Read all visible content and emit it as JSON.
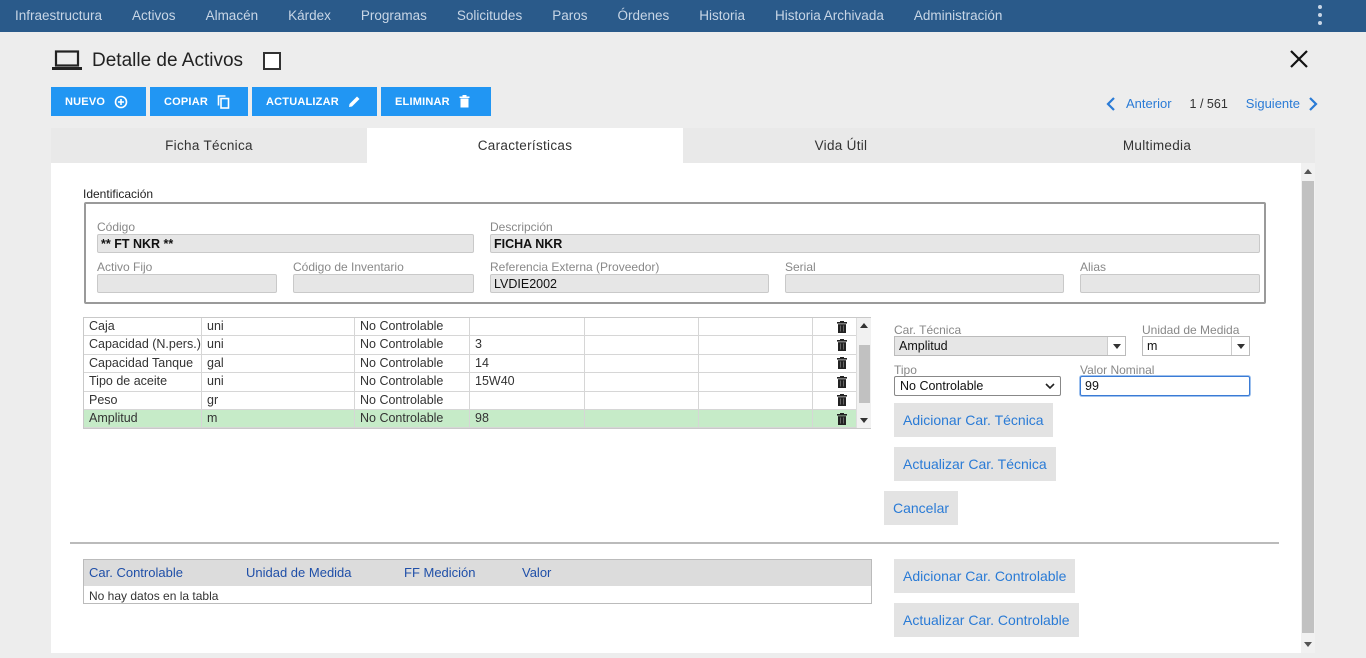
{
  "nav": [
    "Infraestructura",
    "Activos",
    "Almacén",
    "Kárdex",
    "Programas",
    "Solicitudes",
    "Paros",
    "Órdenes",
    "Historia",
    "Historia Archivada",
    "Administración"
  ],
  "page": {
    "title": "Detalle de Activos"
  },
  "toolbar": {
    "nuevo": "NUEVO",
    "copiar": "COPIAR",
    "actualizar": "ACTUALIZAR",
    "eliminar": "ELIMINAR"
  },
  "pager": {
    "prev": "Anterior",
    "count": "1 / 561",
    "next": "Siguiente"
  },
  "tabs": [
    {
      "label": "Ficha Técnica",
      "active": false
    },
    {
      "label": "Características",
      "active": true
    },
    {
      "label": "Vida Útil",
      "active": false
    },
    {
      "label": "Multimedia",
      "active": false
    }
  ],
  "identificacion": {
    "section_label": "Identificación",
    "codigo": {
      "label": "Código",
      "value": "** FT NKR **"
    },
    "descripcion": {
      "label": "Descripción",
      "value": "FICHA NKR"
    },
    "activo_fijo": {
      "label": "Activo Fijo",
      "value": ""
    },
    "codigo_inventario": {
      "label": "Código de Inventario",
      "value": ""
    },
    "referencia_externa": {
      "label": "Referencia Externa (Proveedor)",
      "value": "LVDIE2002"
    },
    "serial": {
      "label": "Serial",
      "value": ""
    },
    "alias": {
      "label": "Alias",
      "value": ""
    }
  },
  "caracteristicas": {
    "rows": [
      {
        "nombre": "Caja",
        "unidad": "uni",
        "tipo": "No Controlable",
        "valor": "",
        "selected": false
      },
      {
        "nombre": "Capacidad (N.pers.)",
        "unidad": "uni",
        "tipo": "No Controlable",
        "valor": "3",
        "selected": false
      },
      {
        "nombre": "Capacidad Tanque",
        "unidad": "gal",
        "tipo": "No Controlable",
        "valor": "14",
        "selected": false
      },
      {
        "nombre": "Tipo de aceite",
        "unidad": "uni",
        "tipo": "No Controlable",
        "valor": "15W40",
        "selected": false
      },
      {
        "nombre": "Peso",
        "unidad": "gr",
        "tipo": "No Controlable",
        "valor": "",
        "selected": false
      },
      {
        "nombre": "Amplitud",
        "unidad": "m",
        "tipo": "No Controlable",
        "valor": "98",
        "selected": true
      }
    ]
  },
  "form": {
    "car_tecnica": {
      "label": "Car. Técnica",
      "value": "Amplitud"
    },
    "unidad_medida": {
      "label": "Unidad de Medida",
      "value": "m"
    },
    "tipo": {
      "label": "Tipo",
      "value": "No Controlable"
    },
    "valor_nominal": {
      "label": "Valor Nominal",
      "value": "99"
    },
    "adicionar_tecnica": "Adicionar Car. Técnica",
    "actualizar_tecnica": "Actualizar Car. Técnica",
    "cancelar": "Cancelar",
    "adicionar_controlable": "Adicionar Car. Controlable",
    "actualizar_controlable": "Actualizar Car. Controlable"
  },
  "controlables": {
    "headers": [
      "Car. Controlable",
      "Unidad de Medida",
      "FF Medición",
      "Valor"
    ],
    "empty": "No hay datos en la tabla"
  },
  "colors": {
    "nav_bg": "#2a5a8a",
    "primary": "#2196f3",
    "link": "#2a7bd6",
    "selected_row": "#c6ebc8"
  }
}
